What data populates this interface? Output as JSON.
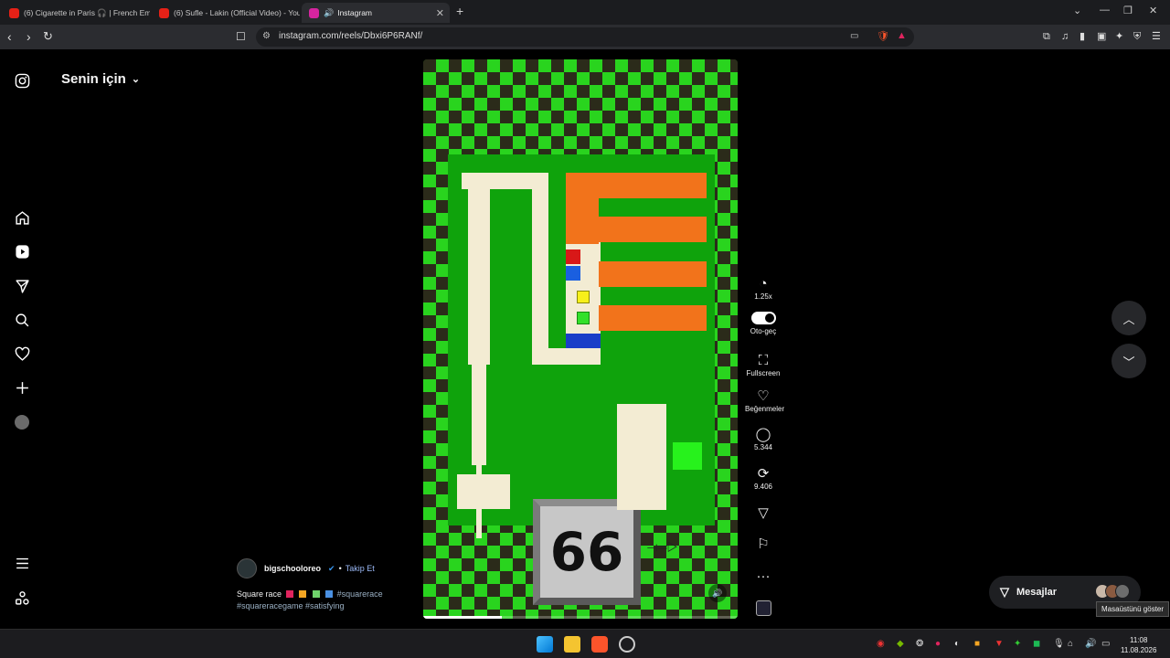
{
  "browser": {
    "tabs": [
      {
        "title": "(6) Cigarette in Paris 🎧 | French Emi",
        "favicon": "youtube-icon",
        "color": "#e62117"
      },
      {
        "title": "(6) Sufle - Lakin (Official Video) - You",
        "favicon": "youtube-icon",
        "color": "#e62117"
      },
      {
        "title": "Instagram",
        "favicon": "instagram-icon",
        "color": "#d6249f",
        "active": true
      }
    ],
    "new_tab": "+",
    "url": "instagram.com/reels/Dbxi6P6RANf/"
  },
  "feed": {
    "title": "Senin için"
  },
  "reel": {
    "counter": "66",
    "progress": 0.25,
    "colors": {
      "checker": "#29d41e",
      "arena": "#0fa30c",
      "track": "#f3ecd3",
      "orange": "#f2731b"
    }
  },
  "actions": {
    "speed": "1.25x",
    "autoplay": "Oto-geç",
    "fullscreen": "Fullscreen",
    "likes": "Beğenmeler",
    "comments": "5.344",
    "reposts": "9.406"
  },
  "post": {
    "author": "bigschooloreo",
    "follow": "Takip Et",
    "caption_title": "Square race",
    "hashtag_1": "#squarerace",
    "hashtag_2": "#squareracegame #satisfying"
  },
  "messages": {
    "label": "Mesajlar",
    "tooltip": "Masaüstünü göster"
  },
  "taskbar": {
    "time": "11:08",
    "date": "11.08.2026"
  }
}
